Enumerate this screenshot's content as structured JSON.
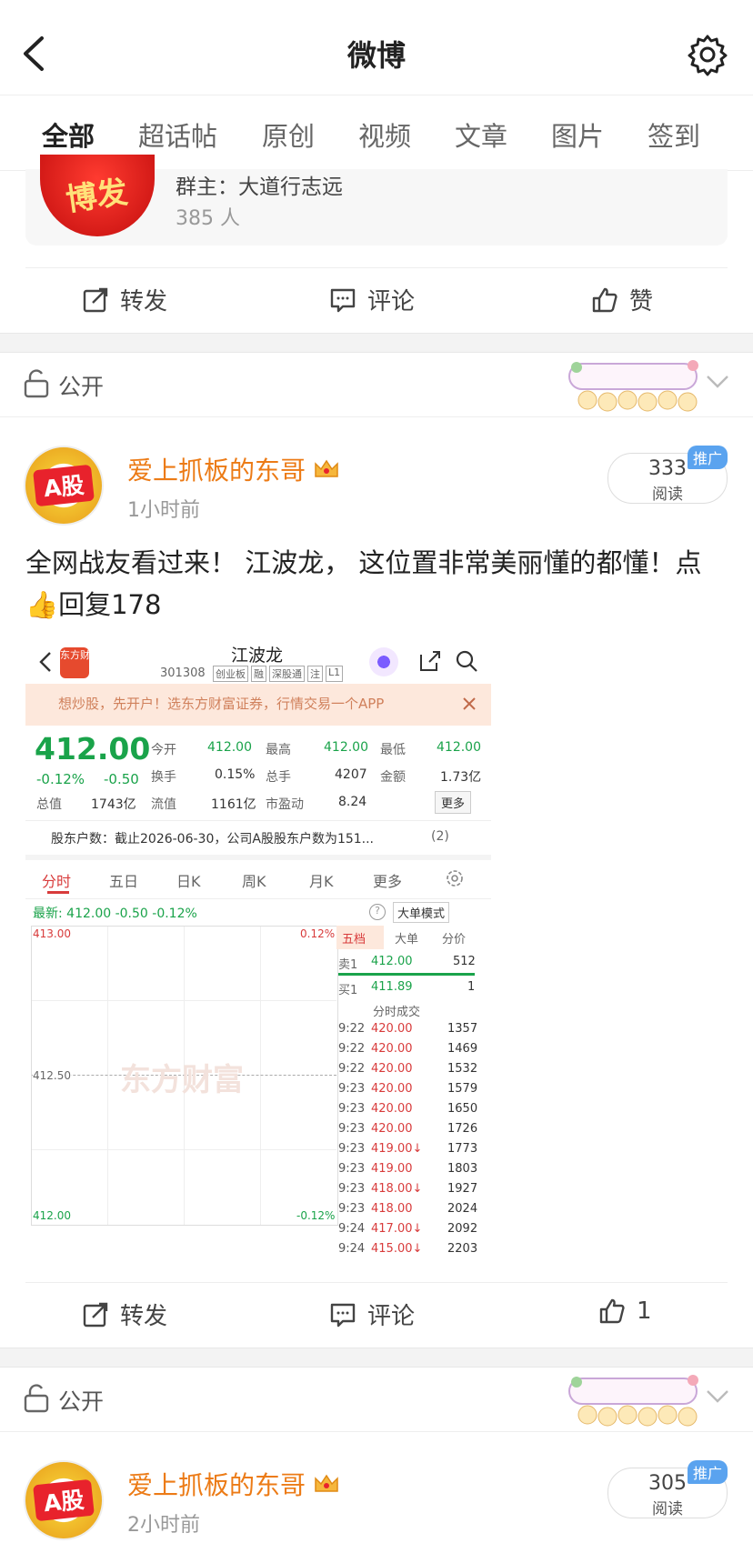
{
  "header": {
    "title": "微博"
  },
  "tabs": [
    "全部",
    "超话帖",
    "原创",
    "视频",
    "文章",
    "图片",
    "签到"
  ],
  "group": {
    "avatar_text": "博发",
    "owner": "群主：大道行志远",
    "count": "385 人"
  },
  "actions1": {
    "repost": "转发",
    "comment": "评论",
    "like": "赞"
  },
  "post1": {
    "visibility": "公开",
    "username": "爱上抓板的东哥",
    "avatar_badge": "A股",
    "time": "1小时前",
    "reads": "333",
    "reads_label": "阅读",
    "promo": "推广",
    "text": "全网战友看过来！   江波龙， 这位置非常美丽懂的都懂！点👍回复178"
  },
  "actions2": {
    "repost": "转发",
    "comment": "评论",
    "like": "1"
  },
  "post2": {
    "visibility": "公开",
    "username": "爱上抓板的东哥",
    "avatar_badge": "A股",
    "time": "2小时前",
    "reads": "305",
    "reads_label": "阅读",
    "promo": "推广"
  },
  "stock": {
    "app_logo": "东方财富",
    "name": "江波龙",
    "code": "301308",
    "tags": [
      "创业板",
      "融",
      "深股通",
      "注",
      "L1"
    ],
    "banner": "想炒股，先开户！选东方财富证券，行情交易一个APP",
    "price": "412.00",
    "change_pct": "-0.12%",
    "change": "-0.50",
    "open_label": "今开",
    "open": "412.00",
    "high_label": "最高",
    "high": "412.00",
    "low_label": "最低",
    "low": "412.00",
    "turnover_label": "换手",
    "turnover": "0.15%",
    "volume_label": "总手",
    "volume": "4207",
    "amount_label": "金额",
    "amount": "1.73亿",
    "mcap_label": "总值",
    "mcap": "1743亿",
    "float_label": "流值",
    "float": "1161亿",
    "pe_label": "市盈动",
    "pe": "8.24",
    "more": "更多",
    "holders": "股东户数：截止2026-06-30，公司A股股东户数为151...",
    "holders_count": "(2)",
    "chart_tabs": [
      "分时",
      "五日",
      "日K",
      "周K",
      "月K",
      "更多"
    ],
    "latest": "最新: 412.00  -0.50  -0.12%",
    "big_order": "大单模式",
    "top_price": "413.00",
    "mid_price": "412.50",
    "bottom_price": "412.00",
    "top_pct": "0.12%",
    "bottom_pct": "-0.12%",
    "watermark": "东方财富",
    "book_tabs": [
      "五档",
      "大单",
      "分价"
    ],
    "sell1": [
      "卖1",
      "412.00",
      "512"
    ],
    "buy1": [
      "买1",
      "411.89",
      "1"
    ],
    "trades_label": "分时成交",
    "trades": [
      [
        "9:22",
        "420.00",
        "1357"
      ],
      [
        "9:22",
        "420.00",
        "1469"
      ],
      [
        "9:22",
        "420.00",
        "1532"
      ],
      [
        "9:23",
        "420.00",
        "1579"
      ],
      [
        "9:23",
        "420.00",
        "1650"
      ],
      [
        "9:23",
        "420.00",
        "1726"
      ],
      [
        "9:23",
        "419.00↓",
        "1773"
      ],
      [
        "9:23",
        "419.00",
        "1803"
      ],
      [
        "9:23",
        "418.00↓",
        "1927"
      ],
      [
        "9:23",
        "418.00",
        "2024"
      ],
      [
        "9:24",
        "417.00↓",
        "2092"
      ],
      [
        "9:24",
        "415.00↓",
        "2203"
      ]
    ]
  }
}
